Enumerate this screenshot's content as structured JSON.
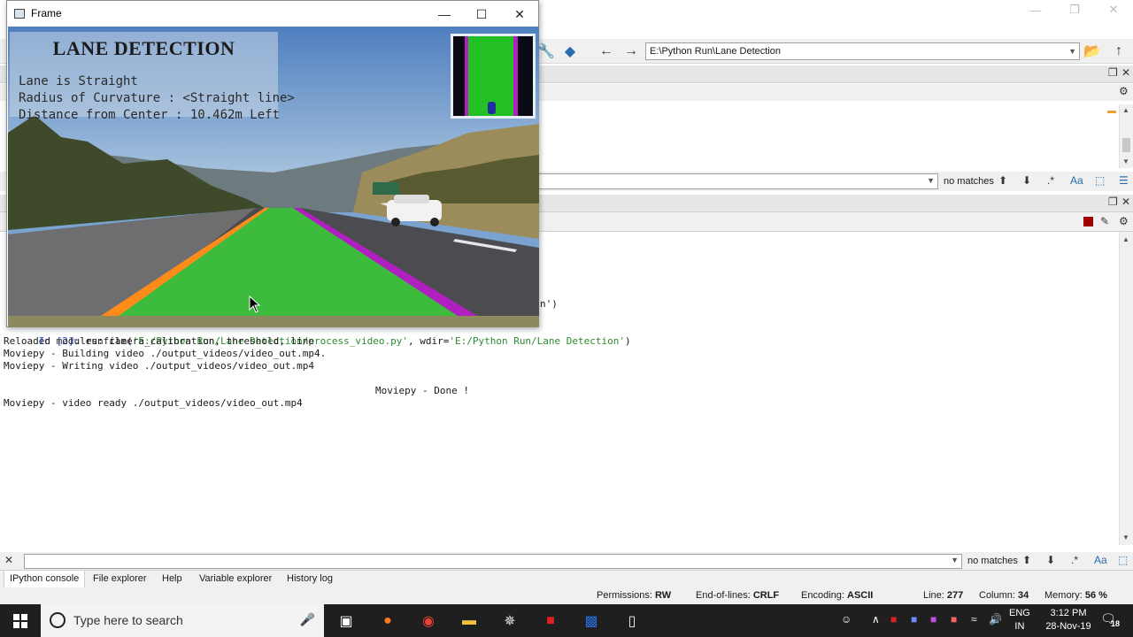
{
  "frame_window": {
    "title": "Frame",
    "overlay": {
      "heading": "LANE DETECTION",
      "line1": "Lane is Straight",
      "line2": "Radius of Curvature : <Straight line>",
      "line3": "Distance from Center : 10.462m Left"
    }
  },
  "toolbar": {
    "path": "E:\\Python Run\\Lane Detection"
  },
  "find": {
    "status": "no matches"
  },
  "console": {
    "partial_line": "n')",
    "lines": [
      {
        "prompt": "In [2]: ",
        "cmd_a": "runfile(",
        "arg1": "'E:/Python Run/Lane Detection/process_video.py'",
        "sep": ", wdir=",
        "arg2": "'E:/Python Run/Lane Detection'",
        "close": ")"
      },
      {
        "text": "Reloaded modules: camera_calibration, threshold, line"
      },
      {
        "text": "Moviepy - Building video ./output_videos/video_out.mp4."
      },
      {
        "text": "Moviepy - Writing video ./output_videos/video_out.mp4"
      },
      {
        "text": "Moviepy - Done !"
      },
      {
        "text": "Moviepy - video ready ./output_videos/video_out.mp4"
      }
    ]
  },
  "bottom_find": {
    "status": "no matches"
  },
  "tabs": [
    "IPython console",
    "File explorer",
    "Help",
    "Variable explorer",
    "History log"
  ],
  "status_bar": {
    "permissions_label": "Permissions:",
    "permissions": "RW",
    "eol_label": "End-of-lines:",
    "eol": "CRLF",
    "encoding_label": "Encoding:",
    "encoding": "ASCII",
    "line_label": "Line:",
    "line": "277",
    "column_label": "Column:",
    "column": "34",
    "memory_label": "Memory:",
    "memory": "56 %"
  },
  "taskbar": {
    "search_placeholder": "Type here to search",
    "lang_line1": "ENG",
    "lang_line2": "IN",
    "time": "3:12 PM",
    "date": "28-Nov-19",
    "notifications": "18"
  },
  "colors": {
    "lane_fill": "#3dbb3d",
    "left_line": "#ff8c1a",
    "right_line": "#b020c0",
    "accent_blue": "#1f4fd6"
  }
}
